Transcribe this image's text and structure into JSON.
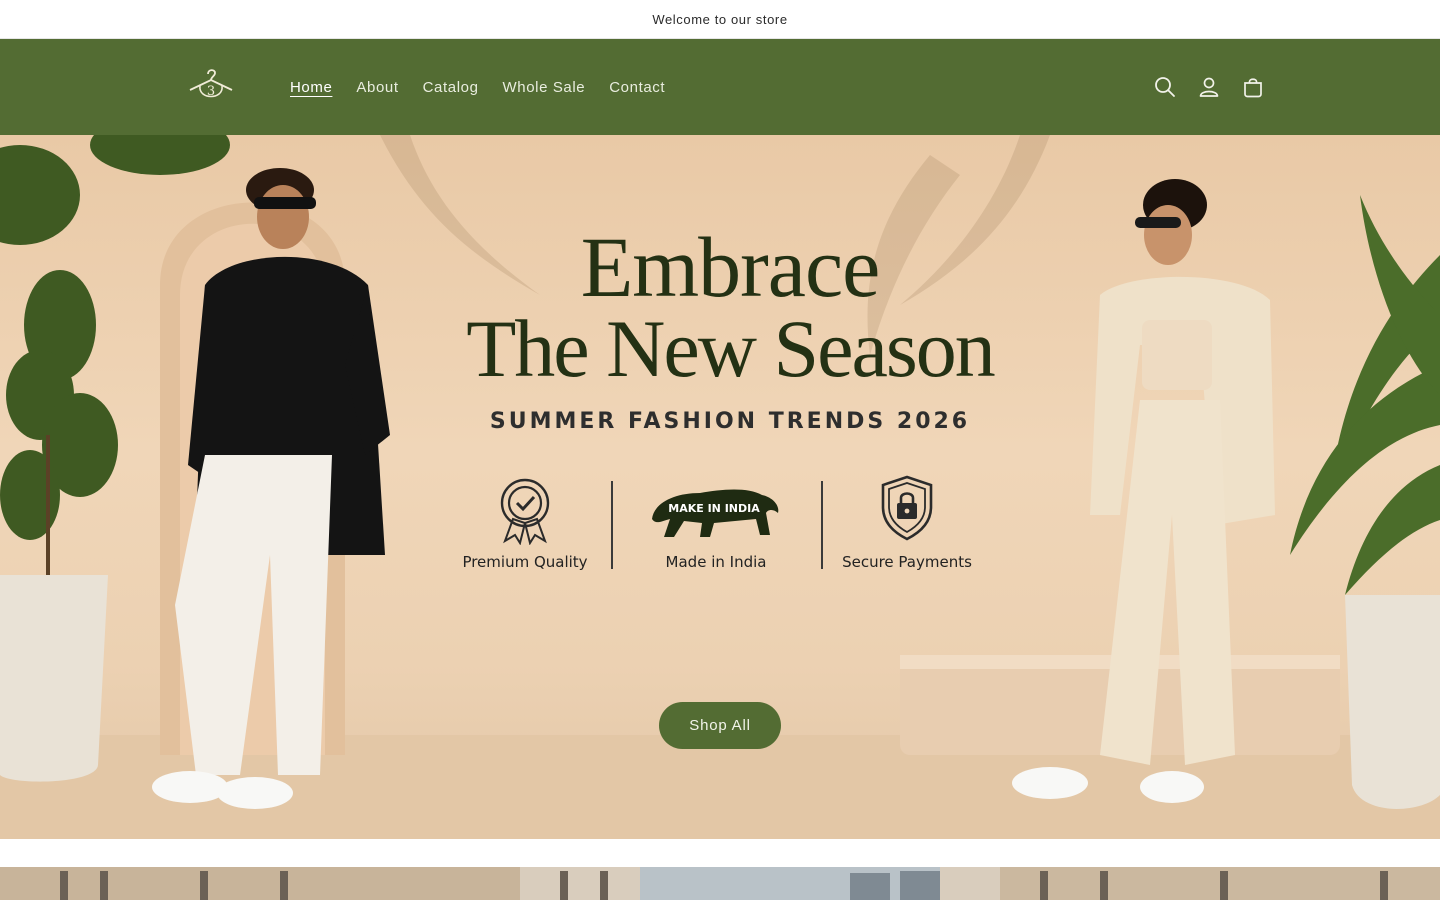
{
  "announcement": {
    "text": "Welcome to our store"
  },
  "brand": {
    "logo_text": "3"
  },
  "nav": {
    "items": [
      {
        "label": "Home",
        "active": true
      },
      {
        "label": "About",
        "active": false
      },
      {
        "label": "Catalog",
        "active": false
      },
      {
        "label": "Whole Sale",
        "active": false
      },
      {
        "label": "Contact",
        "active": false
      }
    ]
  },
  "header_icons": [
    "search-icon",
    "account-icon",
    "cart-icon"
  ],
  "hero": {
    "headline_line1": "Embrace",
    "headline_line2": "The New Season",
    "subheadline": "SUMMER FASHION TRENDS 2026",
    "features": [
      {
        "label": "Premium Quality",
        "icon": "quality-badge-icon"
      },
      {
        "label": "Made in India",
        "icon": "lion-icon",
        "badge_text": "MAKE IN INDIA"
      },
      {
        "label": "Secure Payments",
        "icon": "shield-lock-icon"
      }
    ],
    "cta_label": "Shop All"
  },
  "colors": {
    "brand_green": "#536c33",
    "headline": "#243114",
    "hero_bg": "#f0d6b8"
  }
}
